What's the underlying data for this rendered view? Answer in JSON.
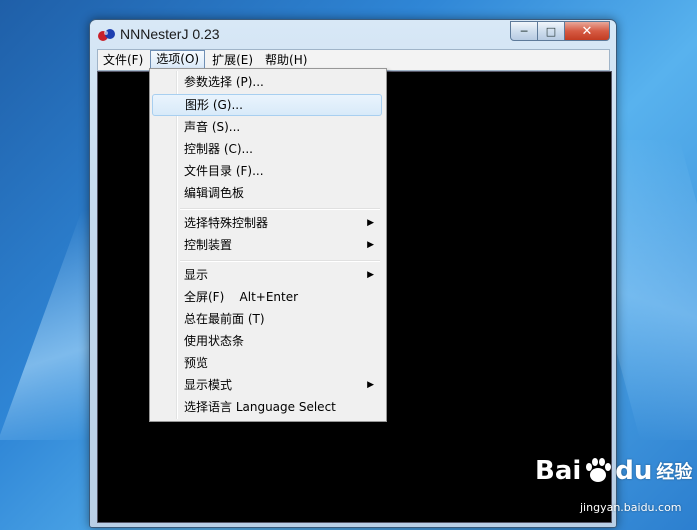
{
  "window": {
    "title": "NNNesterJ 0.23",
    "controls": {
      "minimize": "─",
      "maximize": "□",
      "close": "✕"
    }
  },
  "menubar": {
    "items": [
      {
        "label": "文件(F)"
      },
      {
        "label": "选项(O)"
      },
      {
        "label": "扩展(E)"
      },
      {
        "label": "帮助(H)"
      }
    ]
  },
  "dropdown": {
    "items": [
      {
        "label": "参数选择 (P)..."
      },
      {
        "label": "图形 (G)..."
      },
      {
        "label": "声音 (S)..."
      },
      {
        "label": "控制器 (C)..."
      },
      {
        "label": "文件目录 (F)..."
      },
      {
        "label": "编辑调色板"
      },
      {
        "label": "选择特殊控制器"
      },
      {
        "label": "控制装置"
      },
      {
        "label": "显示"
      },
      {
        "label": "全屏(F)    Alt+Enter"
      },
      {
        "label": "总在最前面 (T)"
      },
      {
        "label": "使用状态条"
      },
      {
        "label": "预览"
      },
      {
        "label": "显示模式"
      },
      {
        "label": "选择语言 Language Select"
      }
    ],
    "submenu_arrow": "▶"
  },
  "watermark": {
    "brand": "Bai",
    "brand2": "du",
    "suffix": "经验",
    "url": "jingyan.baidu.com"
  },
  "colors": {
    "accent": "#2f86d6",
    "client_bg": "#000000",
    "menu_bg": "#f0f0f0"
  }
}
